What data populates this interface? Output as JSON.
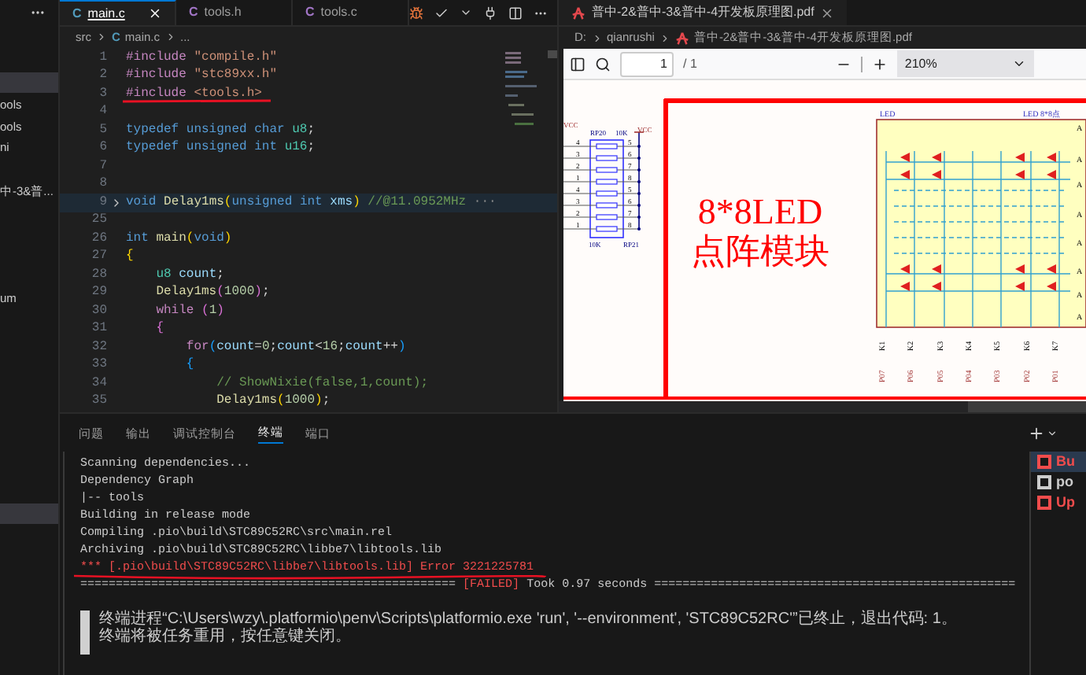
{
  "sidebar": {
    "items": [
      {
        "text": "ools"
      },
      {
        "text": "ools"
      },
      {
        "text": "ni"
      },
      {
        "text": "中-3&普..."
      },
      {
        "text": "um"
      }
    ]
  },
  "editor": {
    "tabs": [
      {
        "icon": "C",
        "label": "main.c",
        "selected": true
      },
      {
        "icon": "C",
        "label": "tools.h",
        "selected": false
      },
      {
        "icon": "C",
        "label": "tools.c",
        "selected": false
      }
    ],
    "breadcrumb": {
      "folder": "src",
      "icon": "C",
      "file": "main.c",
      "more": "..."
    },
    "lines": [
      {
        "num": "1",
        "folded": false,
        "underlined": false,
        "tokens": [
          {
            "kind": "preproc",
            "text": "#include "
          },
          {
            "kind": "string",
            "text": "\"compile.h\""
          }
        ]
      },
      {
        "num": "2",
        "folded": false,
        "underlined": false,
        "tokens": [
          {
            "kind": "preproc",
            "text": "#include "
          },
          {
            "kind": "string",
            "text": "\"stc89xx.h\""
          }
        ]
      },
      {
        "num": "3",
        "folded": false,
        "underlined": true,
        "tokens": [
          {
            "kind": "preproc",
            "text": "#include "
          },
          {
            "kind": "string",
            "text": "<tools.h>"
          }
        ]
      },
      {
        "num": "4",
        "folded": false,
        "underlined": false
      },
      {
        "num": "5",
        "folded": false,
        "underlined": false,
        "tokens": [
          {
            "kind": "keyword",
            "text": "typedef unsigned char "
          },
          {
            "kind": "type",
            "text": "u8"
          },
          {
            "kind": "plain",
            "text": ";"
          }
        ]
      },
      {
        "num": "6",
        "folded": false,
        "underlined": false,
        "tokens": [
          {
            "kind": "keyword",
            "text": "typedef unsigned int "
          },
          {
            "kind": "type",
            "text": "u16"
          },
          {
            "kind": "plain",
            "text": ";"
          }
        ]
      },
      {
        "num": "7",
        "folded": false,
        "underlined": false
      },
      {
        "num": "8",
        "folded": false,
        "underlined": false
      },
      {
        "num": "9",
        "folded": true,
        "underlined": false,
        "tokens": [
          {
            "kind": "keyword",
            "text": "void "
          },
          {
            "kind": "func",
            "text": "Delay1ms"
          },
          {
            "kind": "bracket",
            "text": "("
          },
          {
            "kind": "keyword",
            "text": "unsigned int "
          },
          {
            "kind": "param",
            "text": "xms"
          },
          {
            "kind": "bracket",
            "text": ") "
          },
          {
            "kind": "comment",
            "text": "//@11.0952MHz"
          },
          {
            "kind": "fold",
            "text": " ···"
          }
        ]
      },
      {
        "num": "25",
        "folded": false,
        "underlined": false
      },
      {
        "num": "26",
        "folded": false,
        "underlined": false,
        "tokens": [
          {
            "kind": "keyword",
            "text": "int "
          },
          {
            "kind": "func",
            "text": "main"
          },
          {
            "kind": "bracket",
            "text": "("
          },
          {
            "kind": "keyword",
            "text": "void"
          },
          {
            "kind": "bracket",
            "text": ")"
          }
        ]
      },
      {
        "num": "27",
        "folded": false,
        "underlined": false,
        "tokens": [
          {
            "kind": "bracket",
            "text": "{"
          }
        ]
      },
      {
        "num": "28",
        "folded": false,
        "underlined": false,
        "tokens": [
          {
            "kind": "type",
            "text": "    u8 "
          },
          {
            "kind": "param",
            "text": "count"
          },
          {
            "kind": "plain",
            "text": ";"
          }
        ]
      },
      {
        "num": "29",
        "folded": false,
        "underlined": false,
        "tokens": [
          {
            "kind": "func",
            "text": "    Delay1ms"
          },
          {
            "kind": "paren2",
            "text": "("
          },
          {
            "kind": "number",
            "text": "1000"
          },
          {
            "kind": "paren2",
            "text": ")"
          },
          {
            "kind": "plain",
            "text": ";"
          }
        ]
      },
      {
        "num": "30",
        "folded": false,
        "underlined": false,
        "tokens": [
          {
            "kind": "control",
            "text": "    while "
          },
          {
            "kind": "paren2",
            "text": "("
          },
          {
            "kind": "number",
            "text": "1"
          },
          {
            "kind": "paren2",
            "text": ")"
          }
        ]
      },
      {
        "num": "31",
        "folded": false,
        "underlined": false,
        "tokens": [
          {
            "kind": "paren2",
            "text": "    {"
          }
        ]
      },
      {
        "num": "32",
        "folded": false,
        "underlined": false,
        "tokens": [
          {
            "kind": "control",
            "text": "        for"
          },
          {
            "kind": "paren3",
            "text": "("
          },
          {
            "kind": "param",
            "text": "count"
          },
          {
            "kind": "plain",
            "text": "="
          },
          {
            "kind": "number",
            "text": "0"
          },
          {
            "kind": "plain",
            "text": ";"
          },
          {
            "kind": "param",
            "text": "count"
          },
          {
            "kind": "plain",
            "text": "<"
          },
          {
            "kind": "number",
            "text": "16"
          },
          {
            "kind": "plain",
            "text": ";"
          },
          {
            "kind": "param",
            "text": "count"
          },
          {
            "kind": "plain",
            "text": "++"
          },
          {
            "kind": "paren3",
            "text": ")"
          }
        ]
      },
      {
        "num": "33",
        "folded": false,
        "underlined": false,
        "tokens": [
          {
            "kind": "paren3",
            "text": "        {"
          }
        ]
      },
      {
        "num": "34",
        "folded": false,
        "underlined": false,
        "tokens": [
          {
            "kind": "comment",
            "text": "            // ShowNixie(false,1,count);"
          }
        ]
      },
      {
        "num": "35",
        "folded": false,
        "underlined": false,
        "tokens": [
          {
            "kind": "func",
            "text": "            Delay1ms"
          },
          {
            "kind": "bracket",
            "text": "("
          },
          {
            "kind": "number",
            "text": "1000"
          },
          {
            "kind": "bracket",
            "text": ")"
          },
          {
            "kind": "plain",
            "text": ";"
          }
        ]
      }
    ]
  },
  "pdf": {
    "tab": "普中-2&普中-3&普中-4开发板原理图.pdf",
    "breadcrumb": {
      "drive": "D:",
      "folder": "qianrushi",
      "file": "普中-2&普中-3&普中-4开发板原理图.pdf"
    },
    "page_input": "1",
    "page_total": "/ 1",
    "zoom": "210%",
    "schematic": {
      "title_lines": [
        "8*8LED",
        "点阵模块"
      ],
      "resistor_labels": [
        "VCC",
        "RP20",
        "10K",
        "VCC",
        "10K",
        "RP21"
      ],
      "left_pins": [
        "4",
        "3",
        "2",
        "1",
        "4",
        "3",
        "2",
        "1"
      ],
      "right_pins": [
        "5",
        "6",
        "7",
        "8",
        "5",
        "6",
        "7",
        "8"
      ],
      "matrix_labels": [
        "LED",
        "LED 8*8点"
      ],
      "row_labels": [
        "A",
        "A",
        "A",
        "A",
        "A",
        "A",
        "A",
        "A"
      ],
      "column_labels": [
        "K1",
        "K2",
        "K3",
        "K4",
        "K5",
        "K6",
        "K7"
      ],
      "port_labels": [
        "P07",
        "P06",
        "P05",
        "P04",
        "P03",
        "P02",
        "P01"
      ]
    }
  },
  "panel": {
    "tabs": [
      {
        "label": "问题",
        "selected": false
      },
      {
        "label": "输出",
        "selected": false
      },
      {
        "label": "调试控制台",
        "selected": false
      },
      {
        "label": "终端",
        "selected": true
      },
      {
        "label": "端口",
        "selected": false
      }
    ],
    "terminal_lines": [
      {
        "underlined": false,
        "segments": [
          {
            "kind": "plain",
            "text": "Scanning dependencies..."
          }
        ]
      },
      {
        "underlined": false,
        "segments": [
          {
            "kind": "plain",
            "text": "Dependency Graph"
          }
        ]
      },
      {
        "underlined": false,
        "segments": [
          {
            "kind": "plain",
            "text": "|-- tools"
          }
        ]
      },
      {
        "underlined": false,
        "segments": [
          {
            "kind": "plain",
            "text": "Building in release mode"
          }
        ]
      },
      {
        "underlined": false,
        "segments": [
          {
            "kind": "plain",
            "text": "Compiling .pio\\build\\STC89C52RC\\src\\main.rel"
          }
        ]
      },
      {
        "underlined": false,
        "segments": [
          {
            "kind": "plain",
            "text": "Archiving .pio\\build\\STC89C52RC\\libbe7\\libtools.lib"
          }
        ]
      },
      {
        "underlined": true,
        "segments": [
          {
            "kind": "error",
            "text": "*** [.pio\\build\\STC89C52RC\\libbe7\\libtools.lib] Error 3221225781"
          }
        ]
      },
      {
        "underlined": false,
        "segments": [
          {
            "kind": "plain",
            "text": "===================================================== "
          },
          {
            "kind": "error",
            "text": "[FAILED]"
          },
          {
            "kind": "plain",
            "text": " Took 0.97 seconds ==================================================="
          }
        ]
      }
    ],
    "notices": [
      "终端进程“C:\\Users\\wzy\\.platformio\\penv\\Scripts\\platformio.exe 'run', '--environment', 'STC89C52RC'”已终止，退出代码: 1。",
      "终端将被任务重用，按任意键关闭。"
    ],
    "terminals": [
      {
        "label": "Bu",
        "selected": true,
        "color": "#f14c4c"
      },
      {
        "label": "po",
        "selected": false,
        "color": "#cccccc"
      },
      {
        "label": "Up",
        "selected": false,
        "color": "#f14c4c"
      }
    ]
  }
}
